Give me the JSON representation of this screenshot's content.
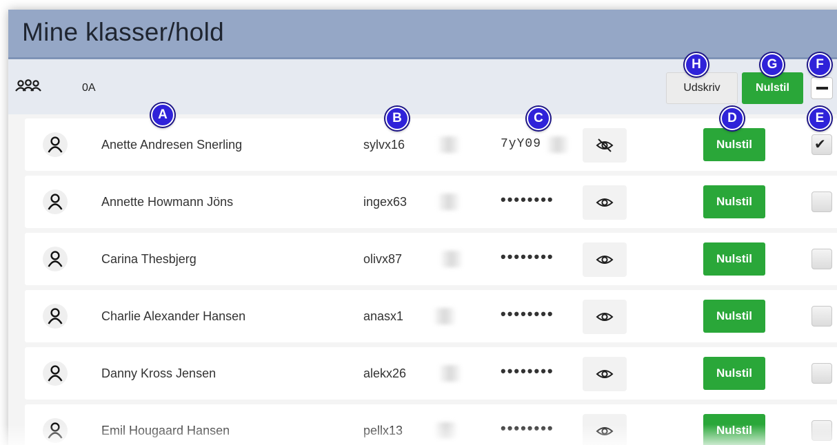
{
  "header": {
    "title": "Mine klasser/hold"
  },
  "class_bar": {
    "class_name": "0A",
    "print_label": "Udskriv",
    "reset_all_label": "Nulstil"
  },
  "students": [
    {
      "name": "Anette Andresen Snerling",
      "username": "sylvx16",
      "password": "7yY09",
      "password_visible": true,
      "checked": true,
      "reset_label": "Nulstil"
    },
    {
      "name": "Annette Howmann Jöns",
      "username": "ingex63",
      "password": "••••••••",
      "password_visible": false,
      "checked": false,
      "reset_label": "Nulstil"
    },
    {
      "name": "Carina Thesbjerg",
      "username": "olivx87",
      "password": "••••••••",
      "password_visible": false,
      "checked": false,
      "reset_label": "Nulstil"
    },
    {
      "name": "Charlie Alexander Hansen",
      "username": "anasx1",
      "password": "••••••••",
      "password_visible": false,
      "checked": false,
      "reset_label": "Nulstil"
    },
    {
      "name": "Danny Kross Jensen",
      "username": "alekx26",
      "password": "••••••••",
      "password_visible": false,
      "checked": false,
      "reset_label": "Nulstil"
    },
    {
      "name": "Emil Hougaard Hansen",
      "username": "pellx13",
      "password": "••••••••",
      "password_visible": false,
      "checked": false,
      "reset_label": "Nulstil"
    }
  ],
  "markers": {
    "a": "A",
    "b": "B",
    "c": "C",
    "d": "D",
    "e": "E",
    "f": "F",
    "g": "G",
    "h": "H"
  },
  "icons": {
    "class": "group-icon",
    "student": "user-icon",
    "password_visible": "eye-slash-icon",
    "password_hidden": "eye-icon",
    "checked": "checkmark-icon",
    "toggle_all": "minus-icon"
  },
  "colors": {
    "title_bar": "#95a7c6",
    "class_bar": "#e6eaf1",
    "reset_button": "#2aa739",
    "marker": "#2f22d9"
  }
}
